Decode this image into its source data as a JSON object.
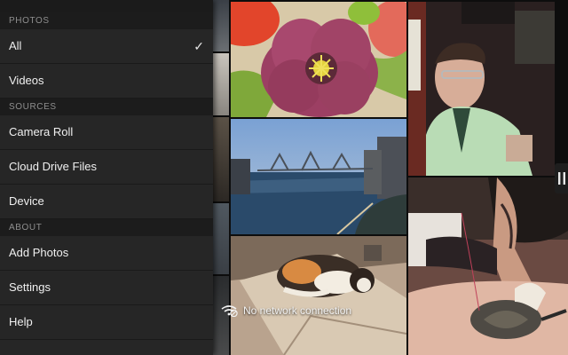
{
  "drawer": {
    "sections": [
      {
        "header": "PHOTOS",
        "items": [
          {
            "label": "All",
            "selected": true
          },
          {
            "label": "Videos"
          }
        ]
      },
      {
        "header": "SOURCES",
        "items": [
          {
            "label": "Camera Roll"
          },
          {
            "label": "Cloud Drive Files"
          },
          {
            "label": "Device"
          }
        ]
      },
      {
        "header": "ABOUT",
        "items": [
          {
            "label": "Add Photos"
          },
          {
            "label": "Settings"
          },
          {
            "label": "Help"
          }
        ]
      }
    ],
    "check_glyph": "✓"
  },
  "toast": {
    "message": "No network connection"
  },
  "colors": {
    "drawer_bg": "#262626",
    "section_bg": "#1c1c1c",
    "text": "#f0f0f0",
    "header_text": "#8f8f8f"
  },
  "icons": {
    "selected": "check-icon",
    "network": "no-network-icon",
    "handle": "pause-icon"
  }
}
